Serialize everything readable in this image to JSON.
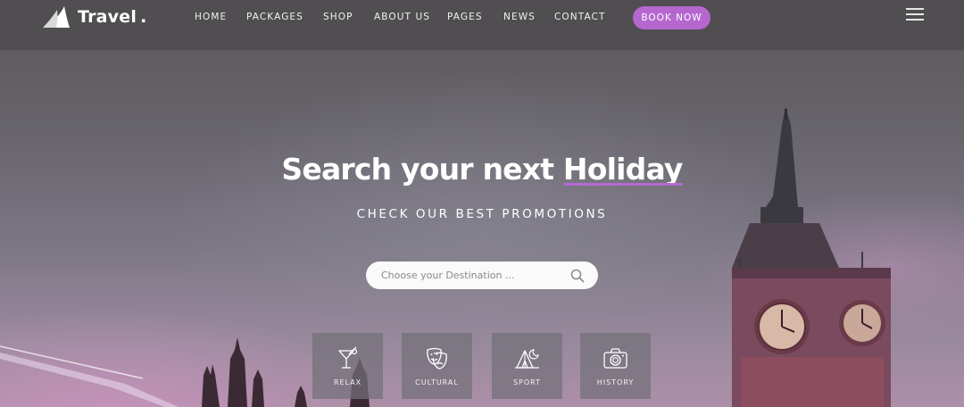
{
  "brand": {
    "name": "Travel",
    "dot": "."
  },
  "nav": {
    "items": [
      {
        "label": "HOME"
      },
      {
        "label": "PACKAGES"
      },
      {
        "label": "SHOP"
      },
      {
        "label": "ABOUT US"
      },
      {
        "label": "PAGES"
      },
      {
        "label": "NEWS"
      },
      {
        "label": "CONTACT"
      }
    ],
    "cta_label": "BOOK NOW",
    "menu_icon": "hamburger-menu-icon"
  },
  "hero": {
    "title_prefix": "Search your next",
    "title_highlight": "Holiday",
    "subtitle": "CHECK OUR BEST PROMOTIONS"
  },
  "search": {
    "placeholder": "Choose your Destination ...",
    "value": "",
    "icon": "search-icon"
  },
  "categories": [
    {
      "label": "RELAX",
      "icon": "cocktail-icon"
    },
    {
      "label": "CULTURAL",
      "icon": "theater-masks-icon"
    },
    {
      "label": "SPORT",
      "icon": "camping-tent-icon"
    },
    {
      "label": "HISTORY",
      "icon": "camera-icon"
    }
  ],
  "colors": {
    "accent": "#b567cf",
    "nav_bg": "#4e4c4e",
    "text": "#ffffff"
  }
}
